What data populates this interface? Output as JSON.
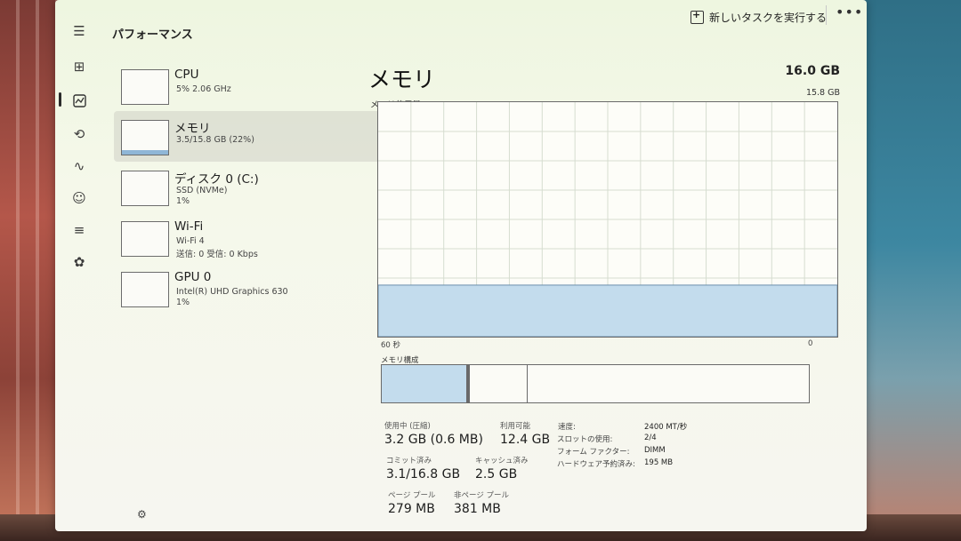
{
  "header": {
    "title": "パフォーマンス",
    "run_task_label": "新しいタスクを実行する",
    "more_label": "•••"
  },
  "rail": {
    "icons": [
      "hamburger-icon",
      "processes-icon",
      "performance-icon",
      "app-history-icon",
      "startup-apps-icon",
      "users-icon",
      "details-icon",
      "services-icon"
    ],
    "settings_icon": "settings-icon"
  },
  "devices": [
    {
      "name": "CPU",
      "line1": "5% 2.06 GHz",
      "line2": ""
    },
    {
      "name": "メモリ",
      "line1": "3.5/15.8 GB (22%)",
      "line2": ""
    },
    {
      "name": "ディスク 0 (C:)",
      "line1": "SSD (NVMe)",
      "line2": "1%"
    },
    {
      "name": "Wi-Fi",
      "line1": "Wi-Fi 4",
      "line2": "送信: 0 受信: 0 Kbps"
    },
    {
      "name": "GPU 0",
      "line1": "Intel(R) UHD Graphics 630",
      "line2": "1%"
    }
  ],
  "main": {
    "title": "メモリ",
    "total": "16.0 GB",
    "usage_label": "メモリ使用量",
    "max_label": "15.8 GB",
    "x_left": "60 秒",
    "x_right": "0",
    "composition_label": "メモリ構成",
    "composition": {
      "in_use_fraction": 0.2,
      "modified_fraction": 0.005,
      "standby_fraction": 0.135,
      "free_fraction": 0.66
    },
    "usage_fraction": 0.22,
    "graph_color": "#c3dced",
    "stats": [
      {
        "label": "使用中 (圧縮)",
        "value": "3.2 GB (0.6 MB)"
      },
      {
        "label": "利用可能",
        "value": "12.4 GB"
      },
      {
        "label": "コミット済み",
        "value": "3.1/16.8 GB"
      },
      {
        "label": "キャッシュ済み",
        "value": "2.5 GB"
      },
      {
        "label": "ページ プール",
        "value": "279 MB"
      },
      {
        "label": "非ページ プール",
        "value": "381 MB"
      }
    ],
    "details": [
      {
        "label": "速度:",
        "value": "2400 MT/秒"
      },
      {
        "label": "スロットの使用:",
        "value": "2/4"
      },
      {
        "label": "フォーム ファクター:",
        "value": "DIMM"
      },
      {
        "label": "ハードウェア予約済み:",
        "value": "195 MB"
      }
    ]
  }
}
